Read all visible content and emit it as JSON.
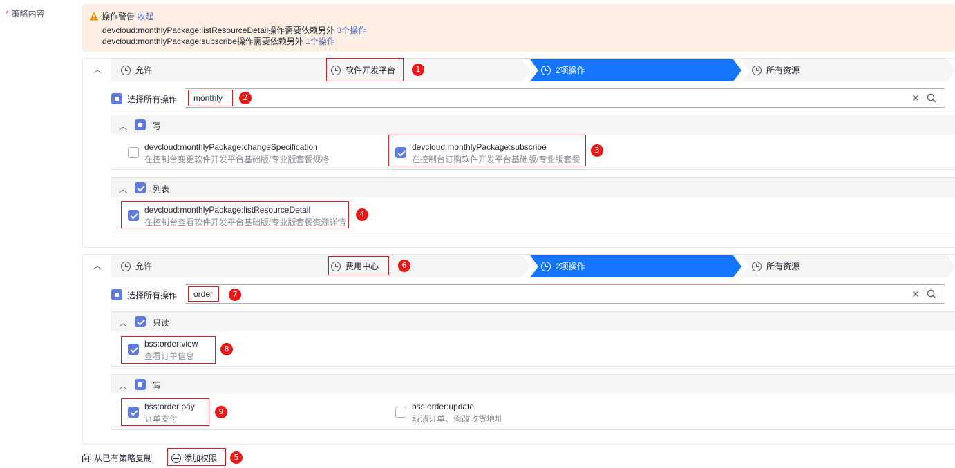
{
  "form": {
    "required_mark": "*",
    "label": "策略内容"
  },
  "warning": {
    "title": "操作警告",
    "collapse_link": "收起",
    "line1_text": "devcloud:monthlyPackage:listResourceDetail操作需要依赖另外",
    "line1_link": "3个操作",
    "line2_text": "devcloud:monthlyPackage:subscribe操作需要依赖另外",
    "line2_link": "1个操作"
  },
  "policies": [
    {
      "steps": [
        "允许",
        "软件开发平台",
        "2项操作",
        "所有资源"
      ],
      "select_all_label": "选择所有操作",
      "search_value": "monthly",
      "groups": [
        {
          "name": "写",
          "state": "partial",
          "actions": [
            {
              "name": "devcloud:monthlyPackage:changeSpecification",
              "desc": "在控制台变更软件开发平台基础版/专业版套餐规格",
              "checked": false
            },
            {
              "name": "devcloud:monthlyPackage:subscribe",
              "desc": "在控制台订购软件开发平台基础版/专业版套餐",
              "checked": true
            }
          ]
        },
        {
          "name": "列表",
          "state": "checked",
          "actions": [
            {
              "name": "devcloud:monthlyPackage:listResourceDetail",
              "desc": "在控制台查看软件开发平台基础版/专业版套餐资源详情",
              "checked": true
            }
          ]
        }
      ]
    },
    {
      "steps": [
        "允许",
        "费用中心",
        "2项操作",
        "所有资源"
      ],
      "select_all_label": "选择所有操作",
      "search_value": "order",
      "groups": [
        {
          "name": "只读",
          "state": "checked",
          "actions": [
            {
              "name": "bss:order:view",
              "desc": "查看订单信息",
              "checked": true
            }
          ]
        },
        {
          "name": "写",
          "state": "partial",
          "actions": [
            {
              "name": "bss:order:pay",
              "desc": "订单支付",
              "checked": true
            },
            {
              "name": "bss:order:update",
              "desc": "取消订单、修改收货地址",
              "checked": false
            }
          ]
        }
      ]
    }
  ],
  "bottom": {
    "copy_label": "从已有策略复制",
    "add_label": "添加权限"
  },
  "annotations": [
    "1",
    "2",
    "3",
    "4",
    "5",
    "6",
    "7",
    "8",
    "9"
  ],
  "colors": {
    "primary": "#1476ff",
    "warning_bg": "#fdf0e3",
    "checkbox": "#5e7ce0",
    "annotation": "#e81919"
  },
  "icons": [
    "warning-icon",
    "clock-icon",
    "search-icon",
    "close-icon",
    "chevron-up-icon",
    "copy-icon",
    "plus-circle-icon"
  ]
}
